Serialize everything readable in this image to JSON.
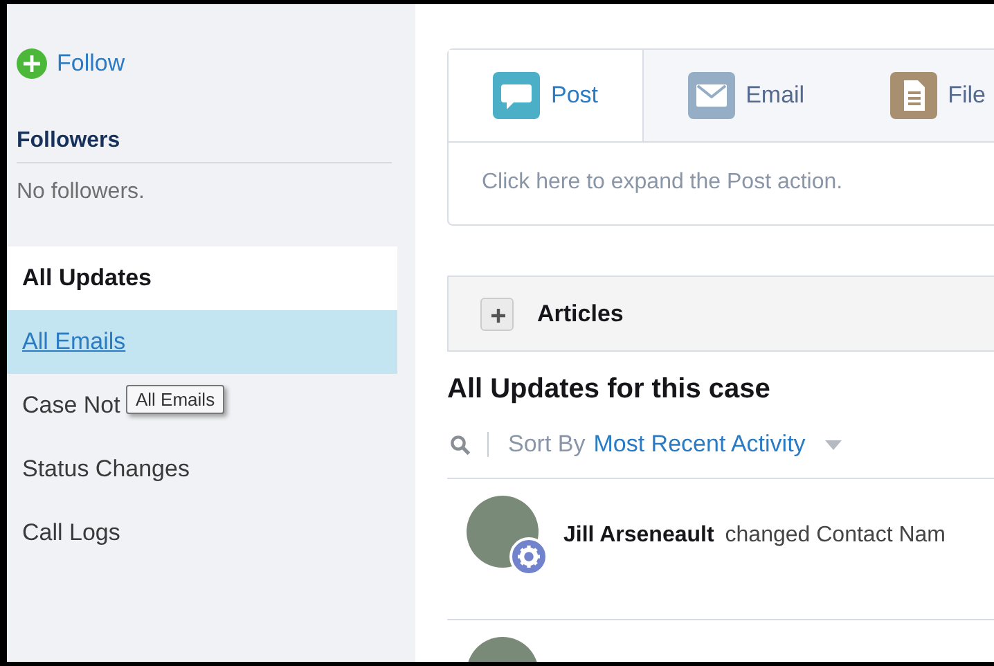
{
  "follow": {
    "label": "Follow"
  },
  "followers": {
    "title": "Followers",
    "empty_text": "No followers."
  },
  "nav": [
    {
      "label": "All Updates",
      "selected": true,
      "hovered": false
    },
    {
      "label": "All Emails",
      "selected": false,
      "hovered": true
    },
    {
      "label": "Case Not",
      "selected": false,
      "hovered": false
    },
    {
      "label": "Status Changes",
      "selected": false,
      "hovered": false
    },
    {
      "label": "Call Logs",
      "selected": false,
      "hovered": false
    }
  ],
  "tooltip": {
    "text": "All Emails"
  },
  "publisher": {
    "tabs": [
      {
        "label": "Post",
        "kind": "post",
        "selected": true
      },
      {
        "label": "Email",
        "kind": "email",
        "selected": false
      },
      {
        "label": "File",
        "kind": "file",
        "selected": false
      }
    ],
    "prompt": "Click here to expand the Post action."
  },
  "articles": {
    "title": "Articles",
    "expanded": false
  },
  "feed": {
    "title": "All Updates for this case",
    "sort_label": "Sort By",
    "sort_value": "Most Recent Activity",
    "items": [
      {
        "author": "Jill Arseneault",
        "action": "changed Contact Nam"
      }
    ]
  }
}
